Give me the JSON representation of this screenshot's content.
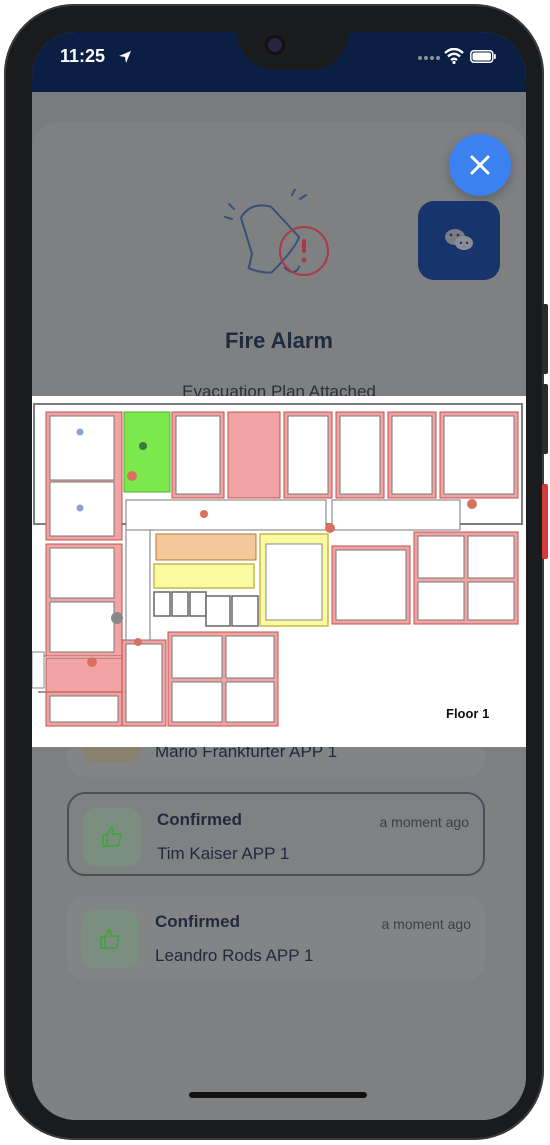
{
  "status_bar": {
    "time": "11:25"
  },
  "alarm": {
    "title": "Fire Alarm",
    "subtitle": "Evacuation Plan Attached"
  },
  "plan": {
    "floor_label": "Floor 1"
  },
  "responses": [
    {
      "status": "",
      "name": "Mario Frankfurter APP 1",
      "when": ""
    },
    {
      "status": "Confirmed",
      "name": "Tim Kaiser APP 1",
      "when": "a moment ago"
    },
    {
      "status": "Confirmed",
      "name": "Leandro Rods APP 1",
      "when": "a moment ago"
    }
  ],
  "colors": {
    "accent": "#3b82f0",
    "chat_button": "#17346c",
    "status_bar": "#0b1f45",
    "alarm_red": "#c9373f",
    "room_red": "#f2a4a4",
    "room_green": "#7be84c",
    "room_yellow": "#fafaa0",
    "room_orange": "#f4c89a"
  },
  "icons": [
    "location-arrow-icon",
    "wifi-icon",
    "battery-icon",
    "close-icon",
    "chat-icon",
    "bell-alert-icon",
    "thumbs-up-icon"
  ]
}
